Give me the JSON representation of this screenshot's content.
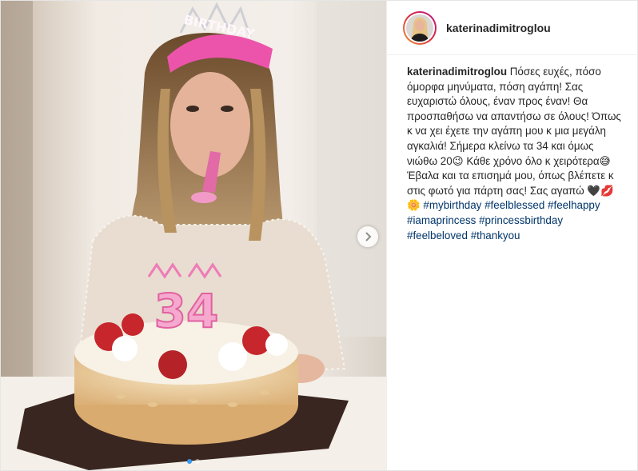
{
  "user": {
    "username": "katerinadimitroglou"
  },
  "caption": {
    "text": "Πόσες ευχές, πόσο όμορφα μηνύματα, πόση αγάπη! Σας ευχαριστώ όλους, έναν προς έναν! Θα προσπαθήσω να απαντήσω σε όλους! Όπως κ να χει έχετε την αγάπη μου κ μια μεγάλη αγκαλιά! Σήμερα κλείνω τα 34 και όμως νιώθω 20😉 Κάθε χρόνο όλο κ χειρότερα😅 Έβαλα και τα επισημά μου, όπως βλέπετε κ στις φωτό για πάρτη σας! Σας αγαπώ 🖤💋🌼",
    "hashtags": [
      "#mybirthday",
      "#feelblessed",
      "#feelhappy",
      "#iamaprincess",
      "#princessbirthday",
      "#feelbeloved",
      "#thankyou"
    ]
  },
  "photo": {
    "tiara_text": "BIRTHDAY",
    "candle_number": "34"
  },
  "carousel": {
    "slide_count": 2,
    "active_index": 0
  },
  "colors": {
    "hashtag": "#003569",
    "active_dot": "#3897f0",
    "tiara": "#e94fa8",
    "candle": "#f6a9cf"
  }
}
